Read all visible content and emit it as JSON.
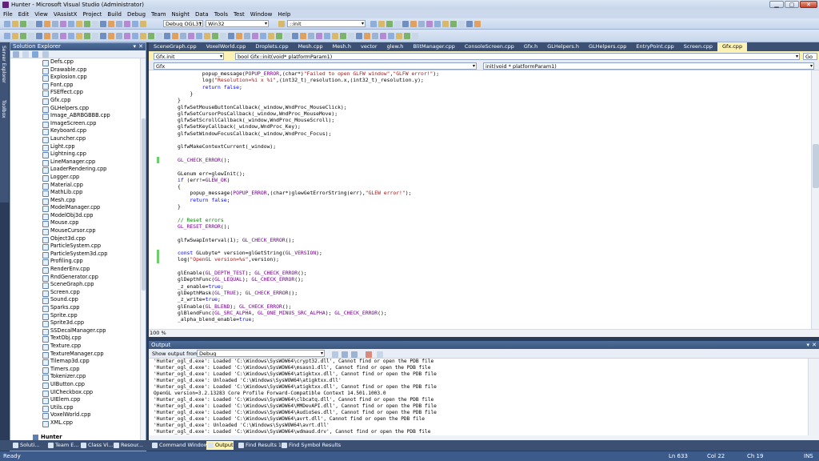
{
  "window": {
    "title": "Hunter - Microsoft Visual Studio (Administrator)",
    "min": "▁",
    "max": "▢",
    "close": "✕"
  },
  "menu": [
    "File",
    "Edit",
    "View",
    "VAssistX",
    "Project",
    "Build",
    "Debug",
    "Team",
    "Nsight",
    "Data",
    "Tools",
    "Test",
    "Window",
    "Help"
  ],
  "toolbar": {
    "config": "Debug OGL31",
    "platform": "Win32",
    "find": "::init"
  },
  "solution_explorer": {
    "title": "Solution Explorer",
    "files": [
      "Defs.cpp",
      "Drawable.cpp",
      "Explosion.cpp",
      "Font.cpp",
      "FSEffect.cpp",
      "Gfx.cpp",
      "GLHelpers.cpp",
      "Image_ABRBGBBB.cpp",
      "ImageScreen.cpp",
      "Keyboard.cpp",
      "Launcher.cpp",
      "Light.cpp",
      "Lightning.cpp",
      "LineManager.cpp",
      "LoaderRendering.cpp",
      "Logger.cpp",
      "Material.cpp",
      "MathLib.cpp",
      "Mesh.cpp",
      "ModelManager.cpp",
      "ModelObj3d.cpp",
      "Mouse.cpp",
      "MouseCursor.cpp",
      "Object3d.cpp",
      "ParticleSystem.cpp",
      "ParticleSystem3d.cpp",
      "Profiling.cpp",
      "RenderEnv.cpp",
      "RndGenerator.cpp",
      "SceneGraph.cpp",
      "Screen.cpp",
      "Sound.cpp",
      "Sparks.cpp",
      "Sprite.cpp",
      "Sprite3d.cpp",
      "SSDecalManager.cpp",
      "TextObj.cpp",
      "Texture.cpp",
      "TextureManager.cpp",
      "Tilemap3d.cpp",
      "Timers.cpp",
      "Tokenizer.cpp",
      "UIButton.cpp",
      "UICheckbox.cpp",
      "UIElem.cpp",
      "Utils.cpp",
      "VoxelWorld.cpp",
      "XML.cpp"
    ],
    "root": "Hunter"
  },
  "side_tabs": [
    "Server Explorer",
    "Toolbox"
  ],
  "doc_tabs": [
    "SceneGraph.cpp",
    "VoxelWorld.cpp",
    "Droplets.cpp",
    "Mesh.cpp",
    "Mesh.h",
    "vector",
    "glew.h",
    "BlitManager.cpp",
    "ConsoleScreen.cpp",
    "Gfx.h",
    "GLHelpers.h",
    "GLHelpers.cpp",
    "EntryPoint.cpp",
    "Screen.cpp",
    "Gfx.cpp"
  ],
  "nav": {
    "file_scope": "Gfx.init",
    "function": "bool Gfx::init(void* platformParam1)",
    "go": "Go",
    "class_scope": "Gfx",
    "member": "init(void * platformParam1)"
  },
  "code": [
    {
      "t": "        popup_message(POPUP_ERROR,(char*)\"Failed to open GLFW window\",\"GLFW error!\");",
      "y": 0
    },
    {
      "t": "        log(\"Resolution=%i x %i\",(int32_t)_resolution.x,(int32_t)_resolution.y);",
      "y": 1
    },
    {
      "t": "        return false;",
      "y": 2
    },
    {
      "t": "    }",
      "y": 3
    },
    {
      "t": "}",
      "y": 4
    },
    {
      "t": "glfwSetMouseButtonCallback(_window,WndProc_MouseClick);",
      "y": 5
    },
    {
      "t": "glfwSetCursorPosCallback(_window,WndProc_MouseMove);",
      "y": 6
    },
    {
      "t": "glfwSetScrollCallback(_window,WndProc_MouseScroll);",
      "y": 7
    },
    {
      "t": "glfwSetKeyCallback(_window,WndProc_Key);",
      "y": 8
    },
    {
      "t": "glfwSetWindowFocusCallback(_window,WndProc_Focus);",
      "y": 9
    },
    {
      "t": "",
      "y": 10
    },
    {
      "t": "glfwMakeContextCurrent(_window);",
      "y": 11
    },
    {
      "t": "",
      "y": 12
    },
    {
      "t": "GL_CHECK_ERROR();",
      "y": 13
    },
    {
      "t": "",
      "y": 14
    },
    {
      "t": "GLenum err=glewInit();",
      "y": 15
    },
    {
      "t": "if (err!=GLEW_OK)",
      "y": 16
    },
    {
      "t": "{",
      "y": 17
    },
    {
      "t": "    popup_message(POPUP_ERROR,(char*)glewGetErrorString(err),\"GLEW error!\");",
      "y": 18
    },
    {
      "t": "    return false;",
      "y": 19
    },
    {
      "t": "}",
      "y": 20
    },
    {
      "t": "",
      "y": 21
    },
    {
      "t": "// Reset errors",
      "y": 22
    },
    {
      "t": "GL_RESET_ERROR();",
      "y": 23
    },
    {
      "t": "",
      "y": 24
    },
    {
      "t": "glfwSwapInterval(1); GL_CHECK_ERROR();",
      "y": 25
    },
    {
      "t": "",
      "y": 26
    },
    {
      "t": "const GLubyte* version=glGetString(GL_VERSION);",
      "y": 27
    },
    {
      "t": "log(\"OpenGL version=%s\",version);",
      "y": 28
    },
    {
      "t": "",
      "y": 29
    },
    {
      "t": "glEnable(GL_DEPTH_TEST); GL_CHECK_ERROR();",
      "y": 30
    },
    {
      "t": "glDepthFunc(GL_LEQUAL); GL_CHECK_ERROR();",
      "y": 31
    },
    {
      "t": "_z_enable=true;",
      "y": 32
    },
    {
      "t": "glDepthMask(GL_TRUE); GL_CHECK_ERROR();",
      "y": 33
    },
    {
      "t": "_z_write=true;",
      "y": 34
    },
    {
      "t": "glEnable(GL_BLEND); GL_CHECK_ERROR();",
      "y": 35
    },
    {
      "t": "glBlendFunc(GL_SRC_ALPHA, GL_ONE_MINUS_SRC_ALPHA); GL_CHECK_ERROR();",
      "y": 36
    },
    {
      "t": "_alpha_blend_enable=true;",
      "y": 37
    },
    {
      "t": "",
      "y": 38
    }
  ],
  "zoom": "100 %",
  "output": {
    "title": "Output",
    "show_from_label": "Show output from:",
    "source": "Debug",
    "lines": [
      "'Hunter_ogl_d.exe': Loaded 'C:\\Windows\\SysWOW64\\crypt32.dll', Cannot find or open the PDB file",
      "'Hunter_ogl_d.exe': Loaded 'C:\\Windows\\SysWOW64\\msasn1.dll', Cannot find or open the PDB file",
      "'Hunter_ogl_d.exe': Loaded 'C:\\Windows\\SysWOW64\\atigktxx.dll', Cannot find or open the PDB file",
      "'Hunter_ogl_d.exe': Unloaded 'C:\\Windows\\SysWOW64\\atigktxx.dll'",
      "'Hunter_ogl_d.exe': Loaded 'C:\\Windows\\SysWOW64\\atigktxx.dll', Cannot find or open the PDB file",
      "OpenGL version=3.2.13283 Core Profile Forward-Compatible Context 14.501.1003.0",
      "'Hunter_ogl_d.exe': Loaded 'C:\\Windows\\SysWOW64\\clbcatq.dll', Cannot find or open the PDB file",
      "'Hunter_ogl_d.exe': Loaded 'C:\\Windows\\SysWOW64\\MMDevAPI.dll', Cannot find or open the PDB file",
      "'Hunter_ogl_d.exe': Loaded 'C:\\Windows\\SysWOW64\\AudioSes.dll', Cannot find or open the PDB file",
      "'Hunter_ogl_d.exe': Loaded 'C:\\Windows\\SysWOW64\\avrt.dll', Cannot find or open the PDB file",
      "'Hunter_ogl_d.exe': Unloaded 'C:\\Windows\\SysWOW64\\avrt.dll'",
      "'Hunter_ogl_d.exe': Loaded 'C:\\Windows\\SysWOW64\\wdmaud.drv', Cannot find or open the PDB file"
    ]
  },
  "bottom_tabs": [
    "Soluti...",
    "Team E...",
    "Class Vi...",
    "Resour...",
    "Command Window",
    "Output",
    "Find Results 1",
    "Find Symbol Results"
  ],
  "status": {
    "ready": "Ready",
    "ln": "Ln 633",
    "col": "Col 22",
    "ch": "Ch 19",
    "ins": "INS"
  },
  "colors": {
    "keyword": "#0000ff",
    "macro": "#6f008a",
    "string": "#a31515",
    "comment": "#008000",
    "active_tab": "#fdf2b5"
  }
}
